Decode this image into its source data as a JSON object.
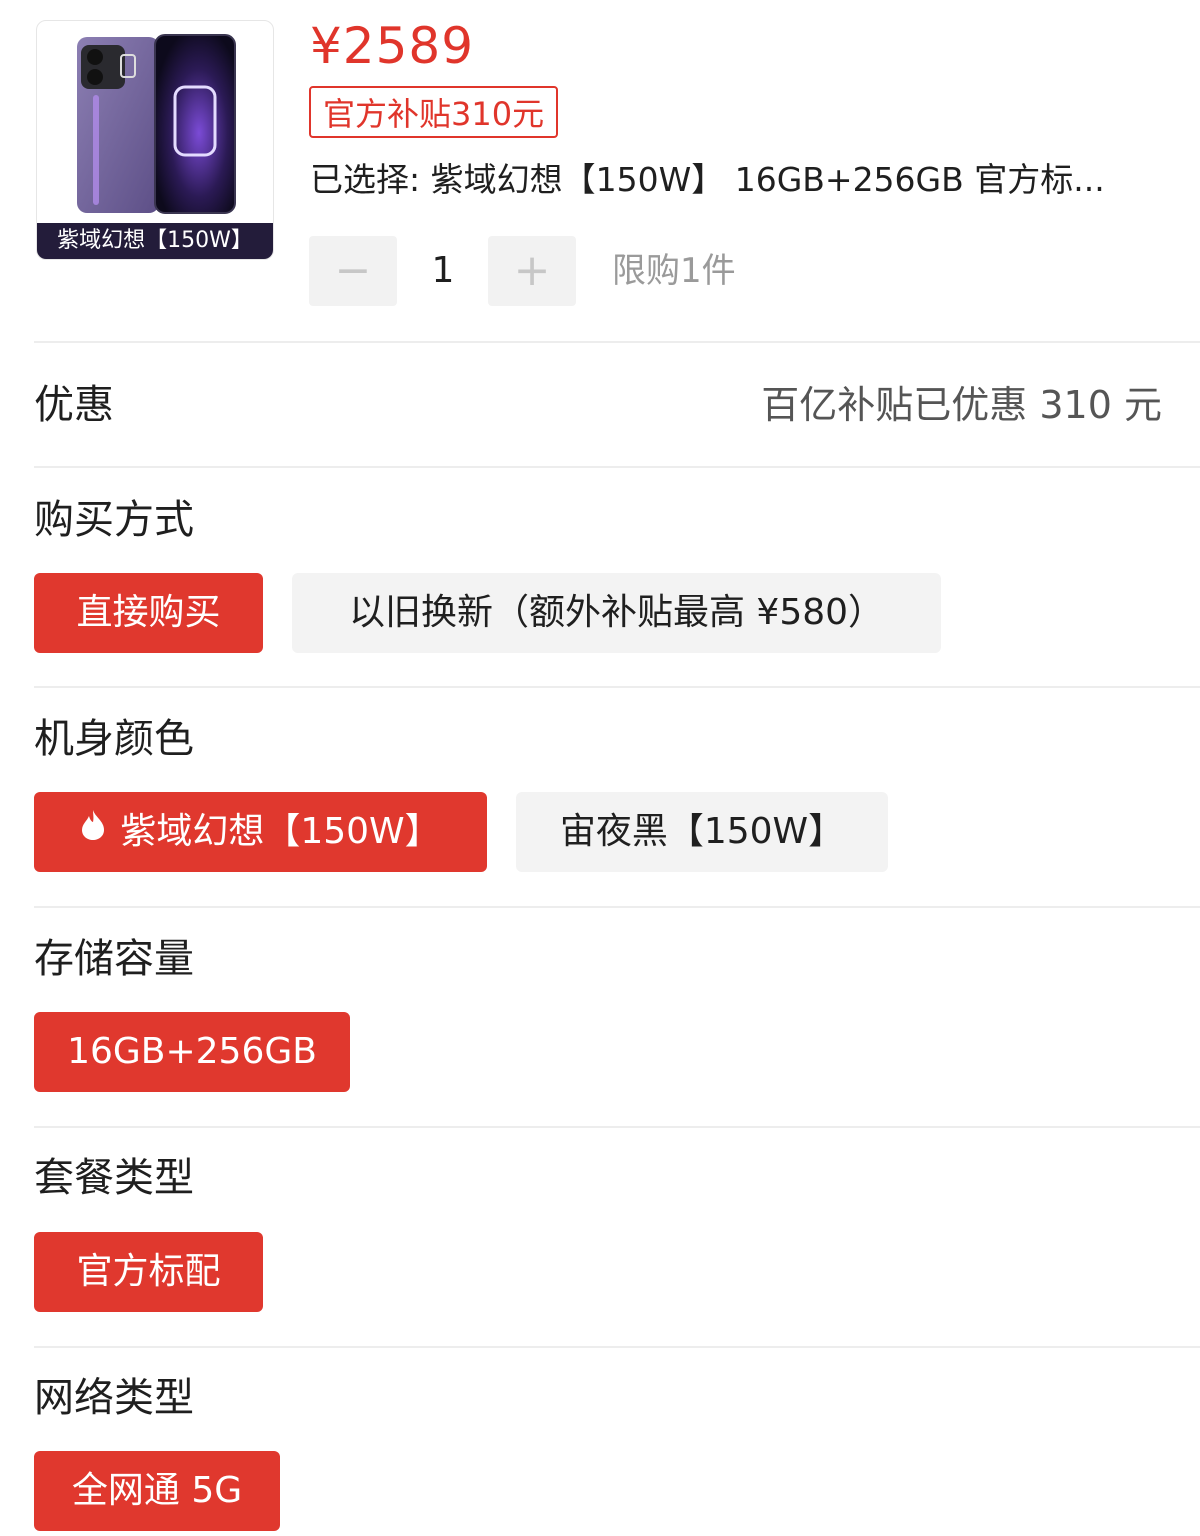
{
  "product": {
    "image_caption": "紫域幻想【150W】",
    "price": "¥2589",
    "subsidy_tag": "官方补贴310元",
    "selected_summary": "已选择: 紫域幻想【150W】 16GB+256GB 官方标..."
  },
  "quantity": {
    "minus": "−",
    "value": "1",
    "plus": "+",
    "limit_text": "限购1件"
  },
  "discount": {
    "label": "优惠",
    "value": "百亿补贴已优惠 310 元"
  },
  "purchase_method": {
    "label": "购买方式",
    "options": [
      {
        "label": "直接购买",
        "selected": true
      },
      {
        "label": "以旧换新（额外补贴最高 ¥580）",
        "selected": false
      }
    ]
  },
  "color": {
    "label": "机身颜色",
    "options": [
      {
        "label": "紫域幻想【150W】",
        "selected": true,
        "icon": "flame-icon"
      },
      {
        "label": "宙夜黑【150W】",
        "selected": false
      }
    ]
  },
  "storage": {
    "label": "存储容量",
    "options": [
      {
        "label": "16GB+256GB",
        "selected": true
      }
    ]
  },
  "package": {
    "label": "套餐类型",
    "options": [
      {
        "label": "官方标配",
        "selected": true
      }
    ]
  },
  "network": {
    "label": "网络类型",
    "options": [
      {
        "label": "全网通 5G",
        "selected": true
      }
    ]
  },
  "colors": {
    "accent": "#e0382e",
    "unselected_bg": "#f3f3f3",
    "text": "#1f1f1f",
    "muted": "#9a9a9a"
  }
}
